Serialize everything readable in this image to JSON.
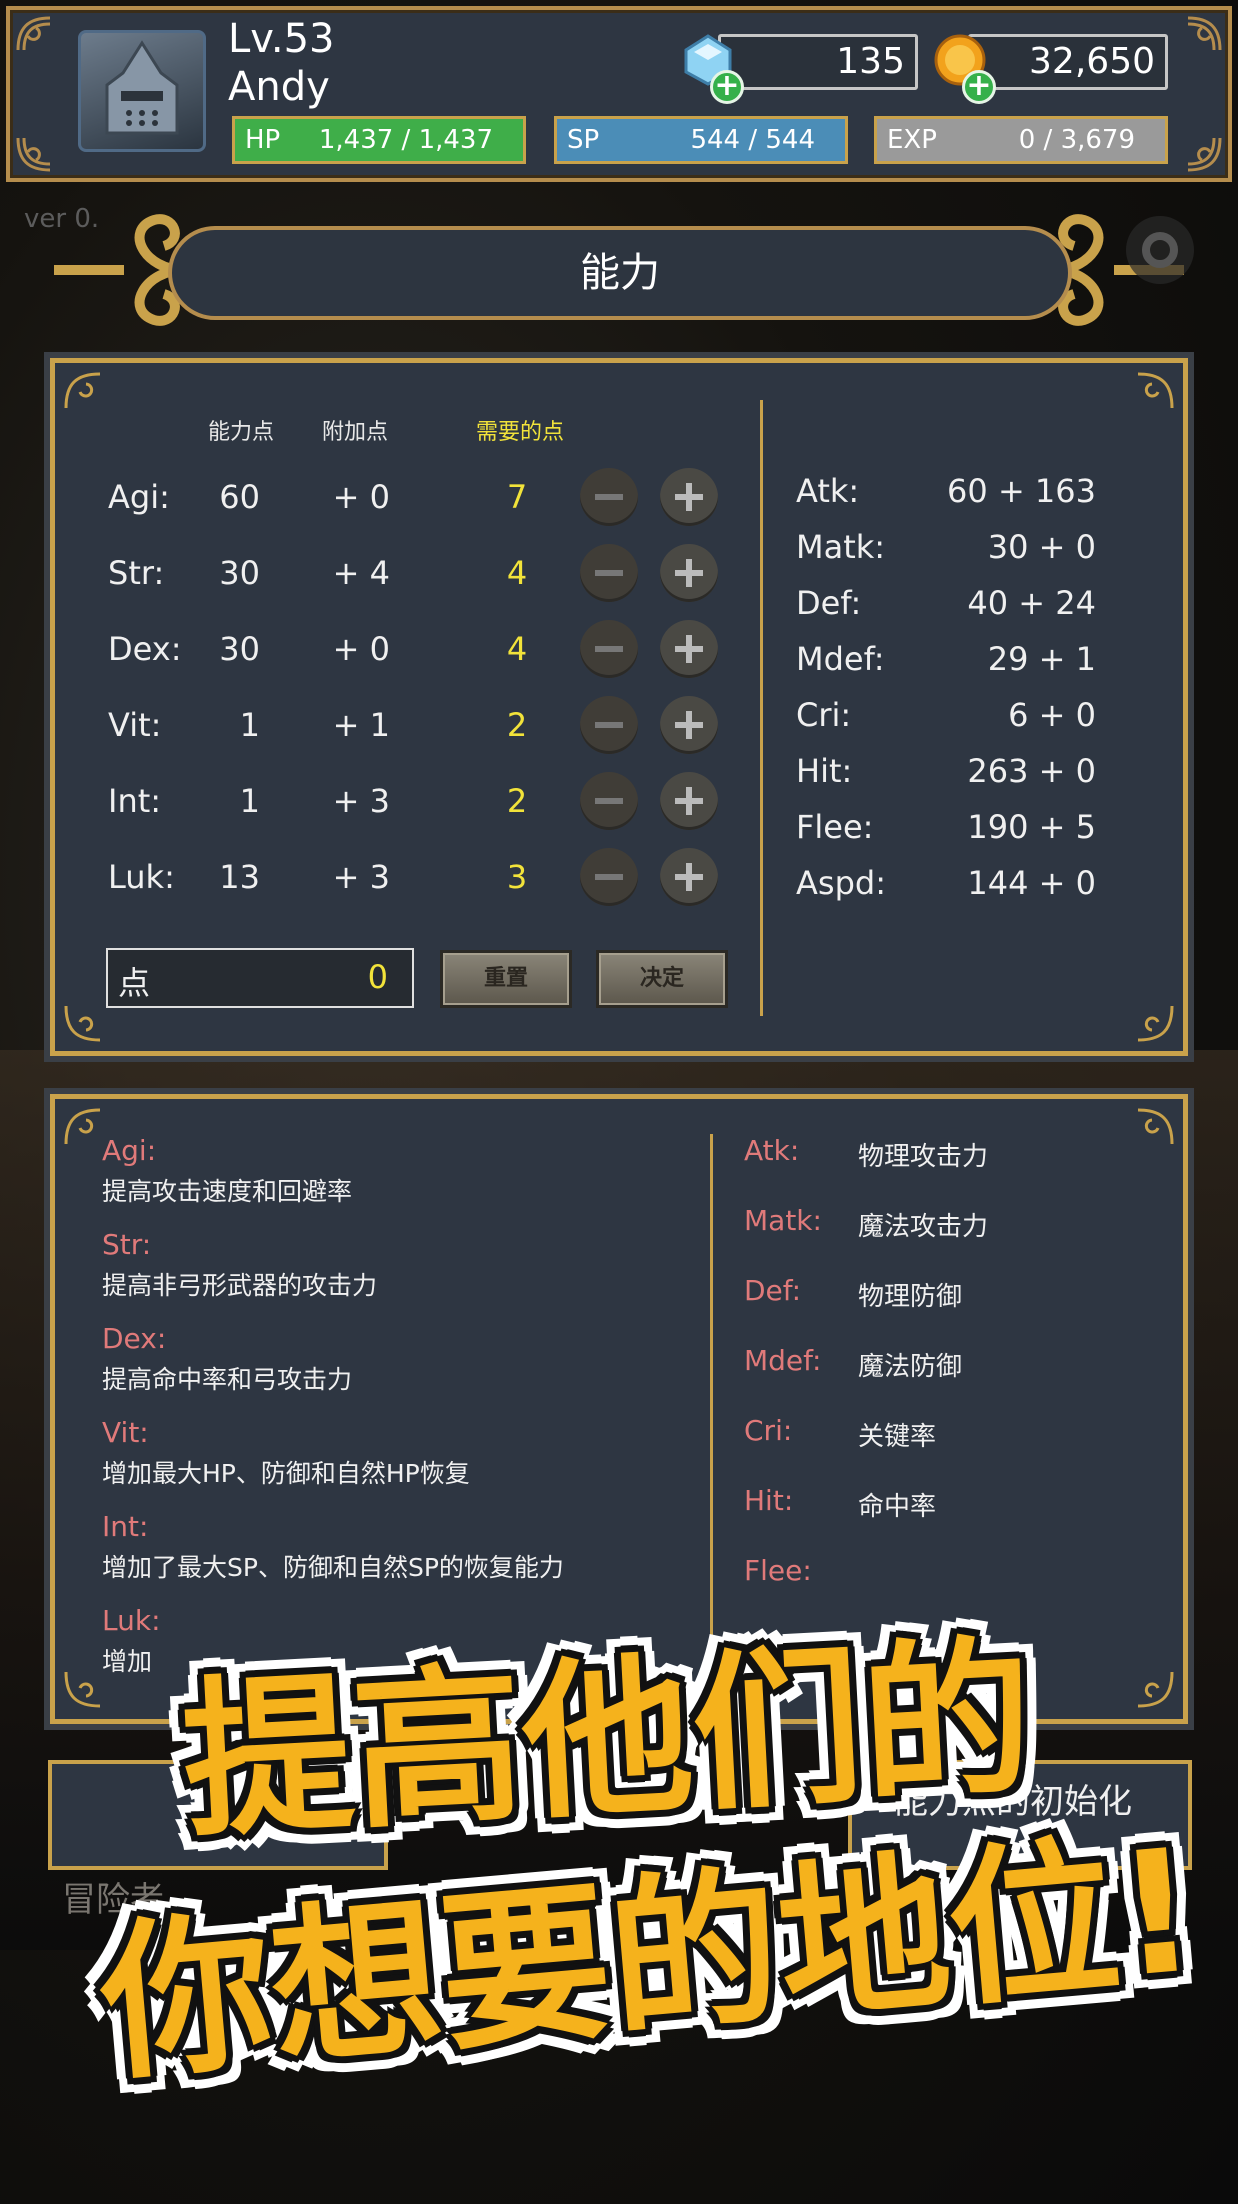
{
  "header": {
    "level": "Lv.53",
    "name": "Andy",
    "gems": "135",
    "gold": "32,650",
    "hp": {
      "label": "HP",
      "value": "1,437 / 1,437",
      "color": "#3fae49"
    },
    "sp": {
      "label": "SP",
      "value": "544 / 544",
      "color": "#4b8db7"
    },
    "exp": {
      "label": "EXP",
      "value": "0 / 3,679",
      "color": "#9a9a9a"
    }
  },
  "version": "ver 0.",
  "title": "能力",
  "stats_panel": {
    "col_points": "能力点",
    "col_bonus": "附加点",
    "col_needed": "需要的点",
    "rows": [
      {
        "name": "Agi:",
        "points": "60",
        "bonus": "+ 0",
        "needed": "7"
      },
      {
        "name": "Str:",
        "points": "30",
        "bonus": "+ 4",
        "needed": "4"
      },
      {
        "name": "Dex:",
        "points": "30",
        "bonus": "+ 0",
        "needed": "4"
      },
      {
        "name": "Vit:",
        "points": "1",
        "bonus": "+ 1",
        "needed": "2"
      },
      {
        "name": "Int:",
        "points": "1",
        "bonus": "+ 3",
        "needed": "2"
      },
      {
        "name": "Luk:",
        "points": "13",
        "bonus": "+ 3",
        "needed": "3"
      }
    ],
    "derived": [
      {
        "name": "Atk:",
        "value": "60 + 163"
      },
      {
        "name": "Matk:",
        "value": "30 + 0"
      },
      {
        "name": "Def:",
        "value": "40 + 24"
      },
      {
        "name": "Mdef:",
        "value": "29 + 1"
      },
      {
        "name": "Cri:",
        "value": "6 + 0"
      },
      {
        "name": "Hit:",
        "value": "263 + 0"
      },
      {
        "name": "Flee:",
        "value": "190 + 5"
      },
      {
        "name": "Aspd:",
        "value": "144 + 0"
      }
    ],
    "points_label": "点",
    "points_value": "0",
    "reset_label": "重置",
    "confirm_label": "决定"
  },
  "desc_panel": {
    "items": [
      {
        "name": "Agi:",
        "text": "提高攻击速度和回避率"
      },
      {
        "name": "Str:",
        "text": "提高非弓形武器的攻击力"
      },
      {
        "name": "Dex:",
        "text": "提高命中率和弓攻击力"
      },
      {
        "name": "Vit:",
        "text": "增加最大HP、防御和自然HP恢复"
      },
      {
        "name": "Int:",
        "text": "增加了最大SP、防御和自然SP的恢复能力"
      },
      {
        "name": "Luk:",
        "text": "增加"
      }
    ],
    "glossary": [
      {
        "name": "Atk:",
        "text": "物理攻击力"
      },
      {
        "name": "Matk:",
        "text": "魔法攻击力"
      },
      {
        "name": "Def:",
        "text": "物理防御"
      },
      {
        "name": "Mdef:",
        "text": "魔法防御"
      },
      {
        "name": "Cri:",
        "text": "关键率"
      },
      {
        "name": "Hit:",
        "text": "命中率"
      },
      {
        "name": "Flee:",
        "text": ""
      }
    ]
  },
  "bottom": {
    "init_label": "能力点的初始化",
    "adventurer_label": "冒险者"
  },
  "promo": {
    "line1": "提高他们的",
    "line2": "你想要的地位!"
  }
}
